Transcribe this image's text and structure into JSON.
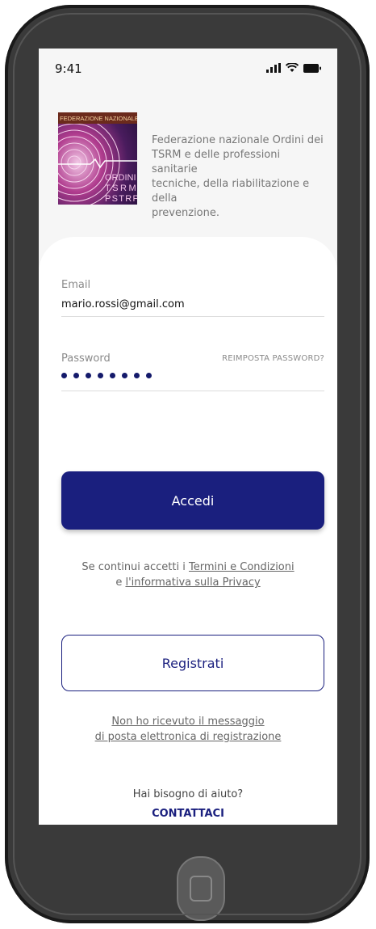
{
  "status": {
    "time": "9:41"
  },
  "header": {
    "logo_text_top": "FEDERAZIONE NAZIONALE",
    "logo_text_ordini": "ORDINI",
    "logo_text_tsrm": "TSRM",
    "logo_text_pstrp": "PSTRP",
    "description_lines": [
      "Federazione nazionale Ordini dei",
      "TSRM e delle professioni sanitarie",
      "tecniche, della riabilitazione e della",
      "prevenzione."
    ]
  },
  "form": {
    "email_label": "Email",
    "email_value": "mario.rossi@gmail.com",
    "password_label": "Password",
    "reset_link": "REIMPOSTA PASSWORD?",
    "password_dot_count": 8,
    "login_button": "Accedi"
  },
  "terms": {
    "line1_prefix": "Se continui accetti i ",
    "line1_link": "Termini e Condizioni",
    "line2_prefix": "e ",
    "line2_link": "l'informativa sulla Privacy"
  },
  "register": {
    "button": "Registrati",
    "resend_line1": "Non ho ricevuto il messaggio",
    "resend_line2": "di posta elettronica di registrazione"
  },
  "help": {
    "question": "Hai bisogno di aiuto?",
    "contact": "CONTATTACI"
  },
  "colors": {
    "primary": "#1a1f7e",
    "phone_frame": "#3a3a3a"
  }
}
